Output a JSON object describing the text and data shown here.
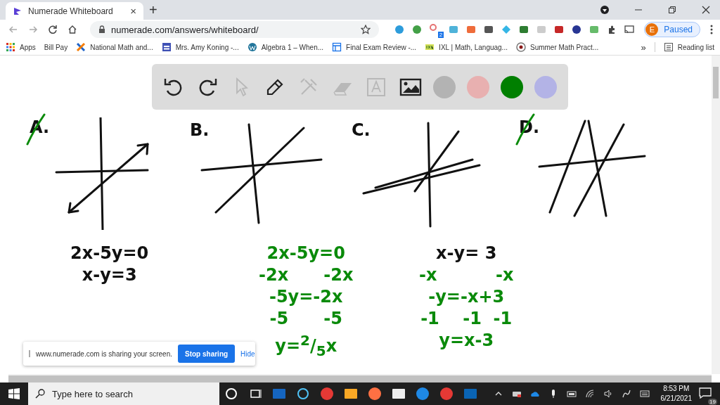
{
  "browser": {
    "tab": {
      "title": "Numerade Whiteboard",
      "close": "×"
    },
    "new_tab": "+",
    "url": "numerade.com/answers/whiteboard/",
    "extension_badge": "2",
    "profile": {
      "initial": "E",
      "status": "Paused"
    }
  },
  "bookmarks": [
    {
      "label": "Apps",
      "kind": "grid"
    },
    {
      "label": "Bill Pay",
      "kind": "none"
    },
    {
      "label": "National Math and...",
      "kind": "cross"
    },
    {
      "label": "Mrs. Amy Koning -...",
      "kind": "calendar"
    },
    {
      "label": "Algebra 1 – When...",
      "kind": "wp"
    },
    {
      "label": "Final Exam Review -...",
      "kind": "sheet"
    },
    {
      "label": "IXL | Math, Languag...",
      "kind": "ixl"
    },
    {
      "label": "Summer Math Pract...",
      "kind": "disc"
    }
  ],
  "bookmarks_more": "»",
  "reading_list": "Reading list",
  "whiteboard": {
    "tools": [
      {
        "kind": "undo",
        "disabled": false
      },
      {
        "kind": "redo",
        "disabled": false
      },
      {
        "kind": "pointer",
        "disabled": true
      },
      {
        "kind": "pen",
        "disabled": false
      },
      {
        "kind": "tools",
        "disabled": true
      },
      {
        "kind": "eraser",
        "disabled": true
      },
      {
        "kind": "text",
        "disabled": true
      },
      {
        "kind": "image",
        "disabled": false
      }
    ],
    "colors": [
      {
        "color": "#b3b3b3"
      },
      {
        "color": "#e8b0b0"
      },
      {
        "color": "#007f00"
      },
      {
        "color": "#b3b3e6"
      }
    ],
    "graphs": [
      {
        "label": "A.",
        "crossed": true
      },
      {
        "label": "B.",
        "crossed": false
      },
      {
        "label": "C.",
        "crossed": false
      },
      {
        "label": "D.",
        "crossed": true
      }
    ],
    "work": [
      {
        "lines": [
          {
            "text": "2x-5y=0",
            "color": "#111111"
          },
          {
            "text": "x-y=3",
            "color": "#111111"
          }
        ]
      },
      {
        "lines": [
          {
            "text": "2x-5y=0",
            "color": "#0a8a0a"
          },
          {
            "text": "-2x      -2x",
            "color": "#0a8a0a"
          },
          {
            "text": "-5y=-2x",
            "color": "#0a8a0a"
          },
          {
            "text": "-5      -5",
            "color": "#0a8a0a"
          },
          {
            "text": "y=$^{2}$/$_{5}$x",
            "color": "#0a8a0a"
          }
        ]
      },
      {
        "lines": [
          {
            "text": "x-y= 3",
            "color": "#111111"
          },
          {
            "text": "-x          -x",
            "color": "#0a8a0a"
          },
          {
            "text": "-y=-x+3",
            "color": "#0a8a0a"
          },
          {
            "text": "-1    -1  -1",
            "color": "#0a8a0a"
          },
          {
            "text": "y=x-3",
            "color": "#0a8a0a"
          }
        ]
      }
    ]
  },
  "share_bar": {
    "message": "www.numerade.com is sharing your screen.",
    "stop": "Stop sharing",
    "hide": "Hide"
  },
  "taskbar": {
    "search_placeholder": "Type here to search",
    "time": "8:53 PM",
    "date": "6/21/2021",
    "notifications": "19"
  }
}
